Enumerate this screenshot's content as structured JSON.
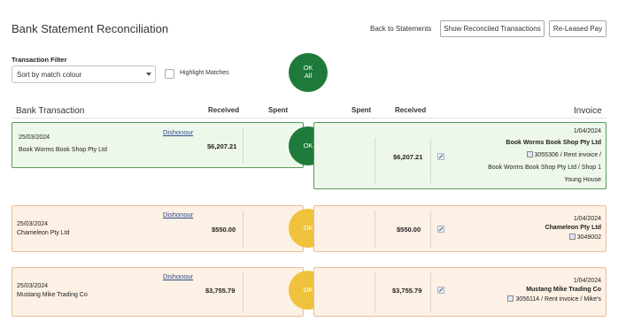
{
  "header": {
    "title": "Bank Statement Reconciliation",
    "back_link": "Back to Statements",
    "show_reconciled_button": "Show Reconciled Transactions",
    "release_pay_button": "Re-Leased Pay"
  },
  "filter": {
    "label": "Transaction Filter",
    "selected": "Sort by match colour",
    "highlight_label": "Highlight Matches",
    "ok_all_line1": "OK",
    "ok_all_line2": "All"
  },
  "columns": {
    "bank_transaction": "Bank Transaction",
    "received_left": "Received",
    "spent_left": "Spent",
    "spent_right": "Spent",
    "received_right": "Received",
    "invoice": "Invoice"
  },
  "rows": [
    {
      "date": "25/03/2024",
      "name": "Book Worms Book Shop Pty Ltd",
      "dishonour": "Dishonour",
      "received": "$6,207.21",
      "ok": "OK",
      "match_received": "$6,207.21",
      "inv_date": "1/04/2024",
      "inv_name": "Book Worms Book Shop Pty Ltd",
      "inv_ref": "3055306 / Rent invoice /",
      "inv_line3": "Book Worms Book Shop Pty Ltd  / Shop 1",
      "inv_line4": "Young House"
    },
    {
      "date": "25/03/2024",
      "name": "Chameleon Pty Ltd",
      "dishonour": "Dishonour",
      "received": "$550.00",
      "ok": "OK",
      "match_received": "$550.00",
      "inv_date": "1/04/2024",
      "inv_name": "Chameleon Pty Ltd",
      "inv_ref": "3049002"
    },
    {
      "date": "25/03/2024",
      "name": "Mustang Mike Trading Co",
      "dishonour": "Dishonour",
      "received": "$3,755.79",
      "ok": "OK",
      "match_received": "$3,755.79",
      "inv_date": "1/04/2024",
      "inv_name": "Mustang Mike Trading Co",
      "inv_ref": "3056114 / Rent invoice / Mike's"
    }
  ],
  "colors": {
    "ok_green": "#1e7a3a",
    "ok_yellow": "#f0c23b",
    "matched_bg": "#eef8ea",
    "partial_bg": "#fdf0e4"
  }
}
